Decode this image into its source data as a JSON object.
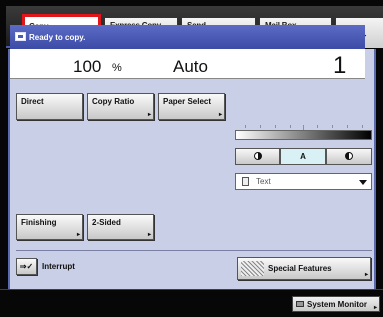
{
  "tabs": {
    "copy": {
      "label": "Copy",
      "icon": "copy-machine-icon"
    },
    "express_copy": {
      "label": "Express Copy",
      "icon": "express-copy-icon"
    },
    "send": {
      "label": "Send",
      "icon": "send-paper-plane-icon"
    },
    "mail_box": {
      "label": "Mail Box",
      "icon": "mailbox-icon"
    },
    "next": {
      "label": "→",
      "icon": "right-arrow-icon"
    }
  },
  "status": {
    "message": "Ready to copy.",
    "icon": "copy-status-icon"
  },
  "readout": {
    "ratio_value": "100",
    "ratio_unit": "%",
    "paper": "Auto",
    "copies": "1"
  },
  "buttons": {
    "direct": "Direct",
    "copy_ratio": "Copy Ratio",
    "paper_select": "Paper Select",
    "finishing": "Finishing",
    "two_sided": "2-Sided",
    "interrupt": "Interrupt",
    "special_features": "Special Features",
    "system_monitor": "System Monitor"
  },
  "density": {
    "auto_label": "A",
    "light_icon": "light-density-icon",
    "dark_icon": "dark-density-icon"
  },
  "original_type": {
    "selected": "Text",
    "icon": "document-icon"
  },
  "colors": {
    "active_tab_border": "#e0161a",
    "status_bar": "#4b5bb8",
    "panel_background": "#c9cfe6",
    "density_auto_highlight": "#d9f1f4"
  }
}
